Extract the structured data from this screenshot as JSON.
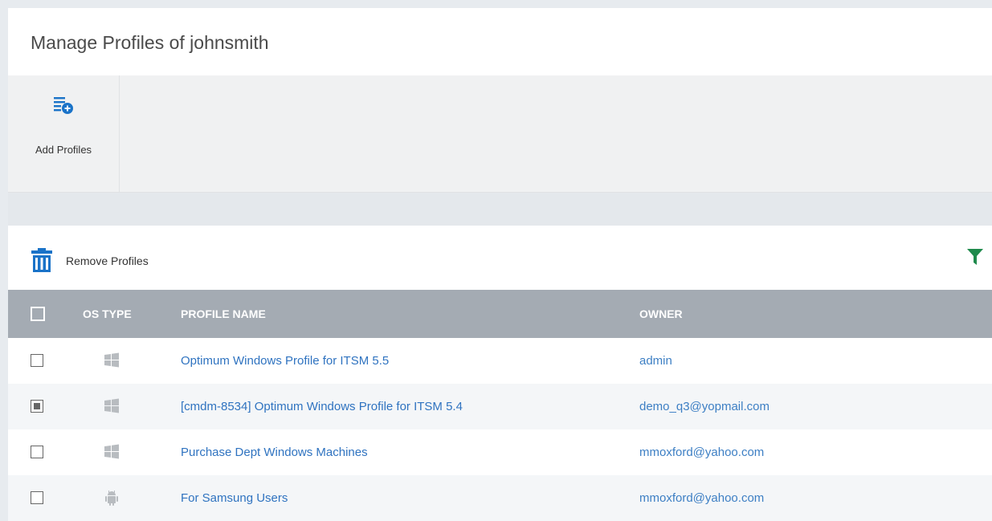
{
  "title": "Manage Profiles of johnsmith",
  "toolbar": {
    "add_profiles": {
      "label": "Add Profiles",
      "icon": "add-list-icon"
    }
  },
  "actions": {
    "remove_profiles": {
      "label": "Remove Profiles",
      "icon": "trash-icon"
    },
    "filter": {
      "icon": "filter-icon"
    }
  },
  "table": {
    "columns": [
      "OS TYPE",
      "PROFILE NAME",
      "OWNER"
    ],
    "rows": [
      {
        "os": "windows",
        "name": "Optimum Windows Profile for ITSM 5.5",
        "owner": "admin",
        "checked": false
      },
      {
        "os": "windows",
        "name": "[cmdm-8534] Optimum Windows Profile for ITSM 5.4",
        "owner": "demo_q3@yopmail.com",
        "checked": "partial"
      },
      {
        "os": "windows",
        "name": "Purchase Dept Windows Machines",
        "owner": "mmoxford@yahoo.com",
        "checked": false
      },
      {
        "os": "android",
        "name": "For Samsung Users",
        "owner": "mmoxford@yahoo.com",
        "checked": false
      }
    ]
  },
  "colors": {
    "accent": "#1a73c8",
    "header_bg": "#a4abb3",
    "link": "#2f73c0",
    "filter": "#1f8a4c"
  }
}
